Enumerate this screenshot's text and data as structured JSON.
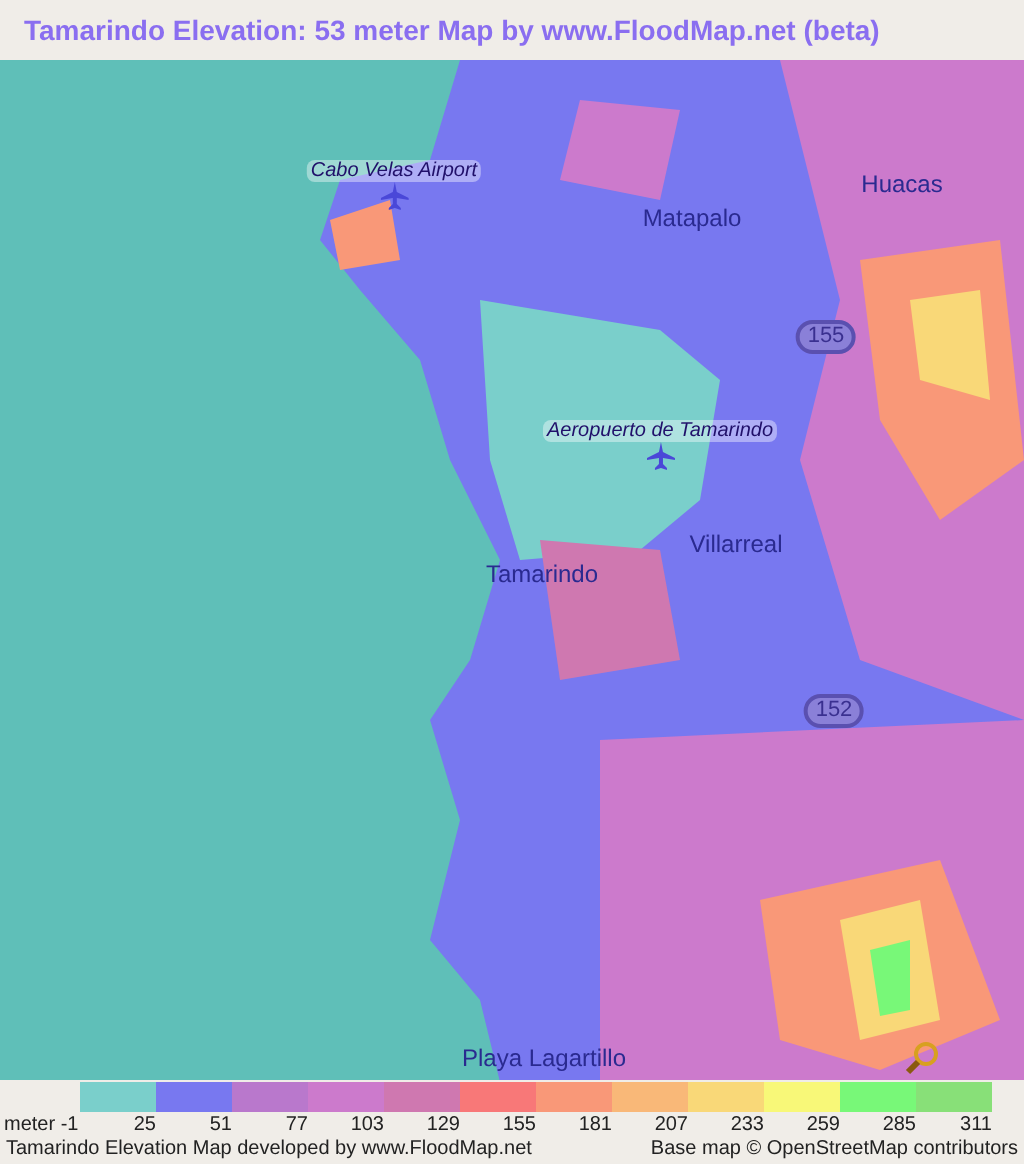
{
  "title": "Tamarindo Elevation: 53 meter Map by www.FloodMap.net (beta)",
  "map": {
    "labels": [
      {
        "kind": "airport",
        "text": "Cabo Velas Airport"
      },
      {
        "kind": "place",
        "text": "Matapalo"
      },
      {
        "kind": "place",
        "text": "Huacas"
      },
      {
        "kind": "route",
        "text": "155"
      },
      {
        "kind": "airport",
        "text": "Aeropuerto de Tamarindo"
      },
      {
        "kind": "place",
        "text": "Villarreal"
      },
      {
        "kind": "place",
        "text": "Tamarindo"
      },
      {
        "kind": "route",
        "text": "152"
      },
      {
        "kind": "place",
        "text": "Playa Lagartillo"
      }
    ]
  },
  "legend": {
    "swatches": [
      {
        "color": "#7acfcb"
      },
      {
        "color": "#7878f0"
      },
      {
        "color": "#b978cc"
      },
      {
        "color": "#cc7acc"
      },
      {
        "color": "#cf78b0"
      },
      {
        "color": "#f87878"
      },
      {
        "color": "#f99878"
      },
      {
        "color": "#f9b878"
      },
      {
        "color": "#f9d878"
      },
      {
        "color": "#f8f878"
      },
      {
        "color": "#78f878"
      },
      {
        "color": "#88e078"
      }
    ],
    "ticks": [
      "meter -1",
      "25",
      "51",
      "77",
      "103",
      "129",
      "155",
      "181",
      "207",
      "233",
      "259",
      "285",
      "311"
    ]
  },
  "footer": {
    "left": "Tamarindo Elevation Map developed by www.FloodMap.net",
    "right": "Base map © OpenStreetMap contributors"
  }
}
